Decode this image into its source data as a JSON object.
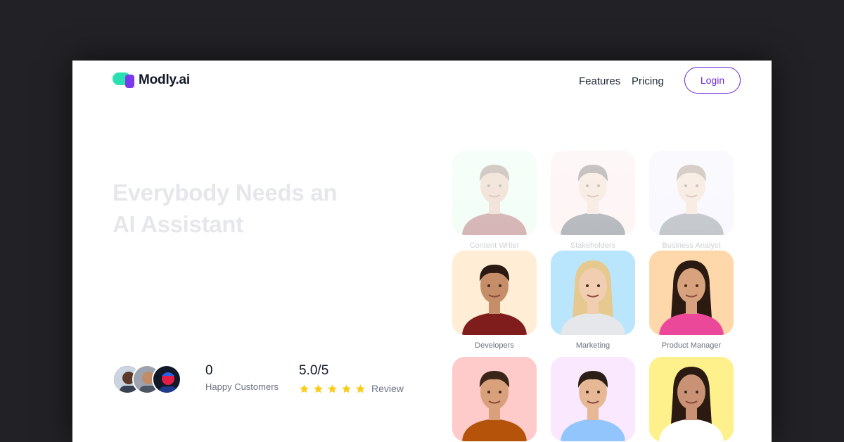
{
  "nav": {
    "brand": "Modly.ai",
    "links": [
      "Features",
      "Pricing"
    ],
    "login_label": "Login"
  },
  "hero": {
    "title_line1": "Everybody Needs an",
    "title_line2": "AI Assistant"
  },
  "stats": {
    "customers_value": "0",
    "customers_label": "Happy Customers",
    "rating_value": "5.0/5",
    "rating_label": "Review",
    "stars": 5
  },
  "roles": [
    {
      "label": "Content Writer",
      "bg": "#dcfce7"
    },
    {
      "label": "Stakeholders",
      "bg": "#fee2e2"
    },
    {
      "label": "Business Analyst",
      "bg": "#ede9fe"
    },
    {
      "label": "Developers",
      "bg": "#ffedd5"
    },
    {
      "label": "Marketing",
      "bg": "#bae6fd"
    },
    {
      "label": "Product Manager",
      "bg": "#fed7aa"
    },
    {
      "label": "",
      "bg": "#fecaca"
    },
    {
      "label": "",
      "bg": "#fae8ff"
    },
    {
      "label": "",
      "bg": "#fef08a"
    }
  ],
  "colors": {
    "brand_green": "#29e0b1",
    "brand_purple": "#7c3aed",
    "login_border": "#6d28d9",
    "star": "#facc15"
  }
}
